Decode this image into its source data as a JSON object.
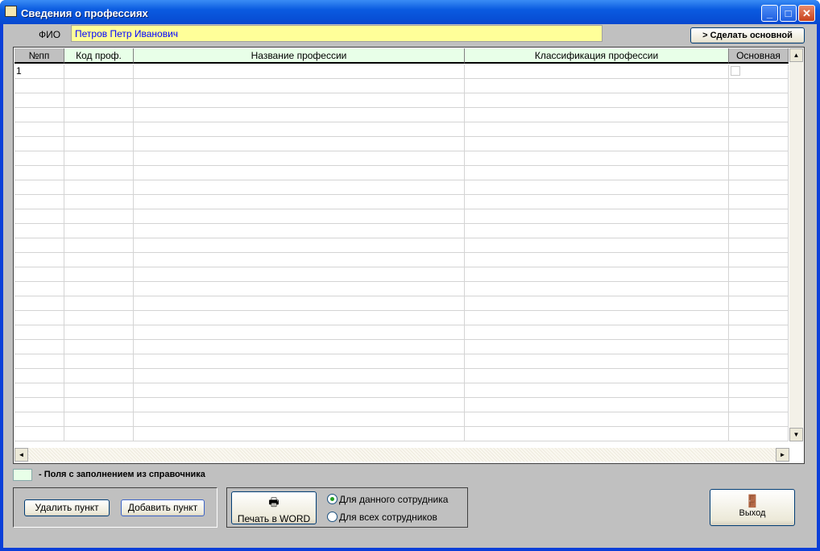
{
  "window": {
    "title": "Сведения о профессиях",
    "minimize": "_",
    "maximize": "□",
    "close": "✕"
  },
  "fio": {
    "label": "ФИО",
    "value": "Петров Петр Иванович"
  },
  "make_main_label": "> Сделать основной",
  "table": {
    "columns": [
      "№пп",
      "Код проф.",
      "Название профессии",
      "Классификация профессии",
      "Основная"
    ],
    "rows": [
      {
        "num": "1",
        "code": "",
        "name": "",
        "class": "",
        "main": false
      }
    ]
  },
  "legend": {
    "text": "-  Поля с заполнением из справочника",
    "color": "#e8ffe8"
  },
  "buttons": {
    "delete": "Удалить пункт",
    "add": "Добавить пункт",
    "print": "Печать в WORD",
    "exit": "Выход"
  },
  "print_scope": {
    "options": [
      "Для данного сотрудника",
      "Для всех сотрудников"
    ],
    "selected": 0
  }
}
